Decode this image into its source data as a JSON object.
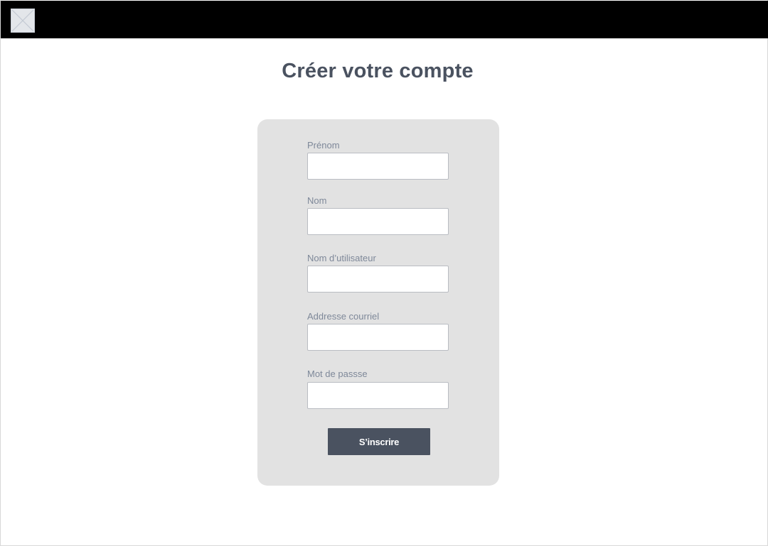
{
  "header": {
    "logo_icon": "broken-image-icon"
  },
  "title": "Créer votre compte",
  "form": {
    "fields": [
      {
        "label": "Prénom",
        "value": "",
        "placeholder": ""
      },
      {
        "label": "Nom",
        "value": "",
        "placeholder": ""
      },
      {
        "label": "Nom d’utilisateur",
        "value": "",
        "placeholder": ""
      },
      {
        "label": "Addresse courriel",
        "value": "",
        "placeholder": ""
      },
      {
        "label": "Mot de passse",
        "value": "",
        "placeholder": ""
      }
    ],
    "submit_label": "S’inscrire"
  },
  "colors": {
    "topbar": "#000000",
    "title": "#4a5260",
    "card_bg": "#e2e2e2",
    "label": "#7e8899",
    "button_bg": "#4a5260",
    "button_text": "#ffffff"
  }
}
